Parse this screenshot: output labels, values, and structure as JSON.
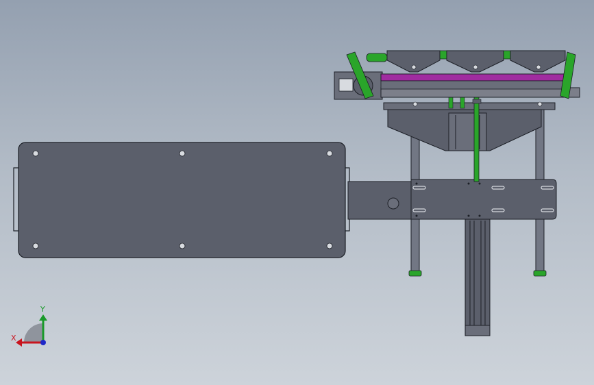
{
  "viewport": {
    "background_top": "#94a0b0",
    "background_bottom": "#cdd3da"
  },
  "model": {
    "body_color": "#5b5f6b",
    "edge_color": "#1c1f26",
    "accent_green": "#2aa52a",
    "accent_magenta": "#a02ca0",
    "rod_color": "#727784"
  },
  "triad": {
    "x_label": "X",
    "y_label": "Y",
    "x_color": "#c8141e",
    "y_color": "#1a9a2a",
    "z_color": "#1e28c8"
  }
}
